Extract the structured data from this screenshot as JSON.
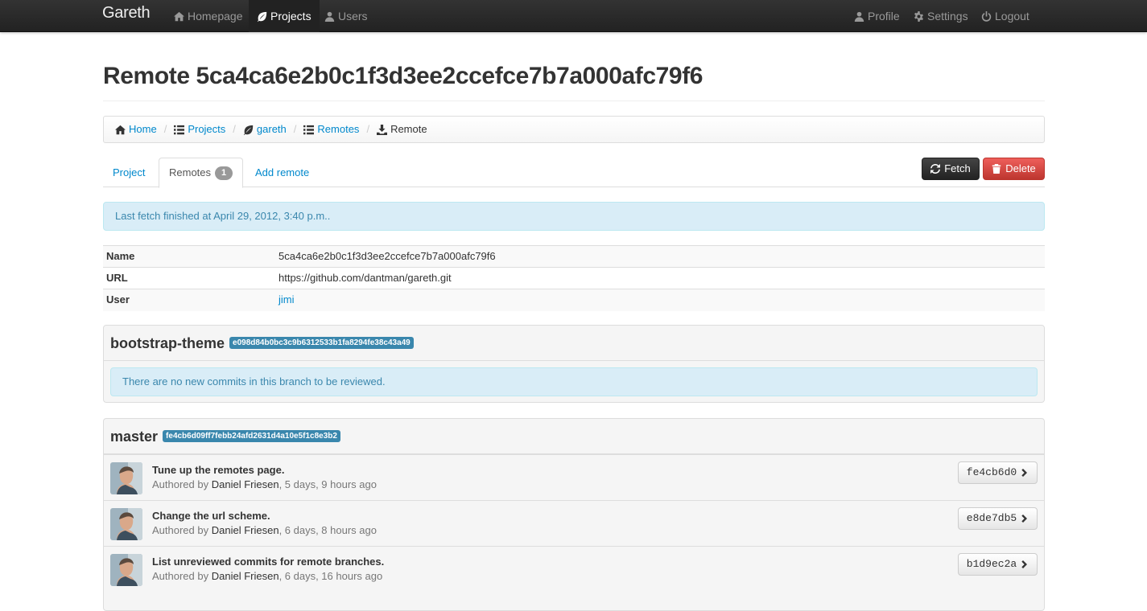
{
  "navbar": {
    "brand": "Gareth",
    "items": [
      {
        "label": "Homepage",
        "icon": "home-icon"
      },
      {
        "label": "Projects",
        "icon": "leaf-icon",
        "active": true
      },
      {
        "label": "Users",
        "icon": "user-icon"
      }
    ],
    "right_items": [
      {
        "label": "Profile",
        "icon": "user-icon"
      },
      {
        "label": "Settings",
        "icon": "gear-icon"
      },
      {
        "label": "Logout",
        "icon": "power-icon"
      }
    ]
  },
  "page": {
    "title": "Remote 5ca4ca6e2b0c1f3d3ee2ccefce7b7a000afc79f6"
  },
  "breadcrumb": [
    {
      "label": "Home",
      "icon": "home-icon"
    },
    {
      "label": "Projects",
      "icon": "list-icon"
    },
    {
      "label": "gareth",
      "icon": "leaf-icon"
    },
    {
      "label": "Remotes",
      "icon": "list-icon"
    },
    {
      "label": "Remote",
      "icon": "download-icon",
      "active": true
    }
  ],
  "tabs": {
    "project": "Project",
    "remotes": "Remotes",
    "remotes_count": "1",
    "add_remote": "Add remote"
  },
  "actions": {
    "fetch": "Fetch",
    "delete": "Delete"
  },
  "fetch_alert": "Last fetch finished at April 29, 2012, 3:40 p.m..",
  "details": [
    {
      "key": "Name",
      "value": "5ca4ca6e2b0c1f3d3ee2ccefce7b7a000afc79f6"
    },
    {
      "key": "URL",
      "value": "https://github.com/dantman/gareth.git"
    },
    {
      "key": "User",
      "value": "jimi"
    }
  ],
  "branches": [
    {
      "name": "bootstrap-theme",
      "sha": "e098d84b0bc3c9b6312533b1fa8294fe38c43a49",
      "empty_message": "There are no new commits in this branch to be reviewed."
    },
    {
      "name": "master",
      "sha": "fe4cb6d09ff7febb24afd2631d4a10e5f1c8e3b2",
      "commits": [
        {
          "title": "Tune up the remotes page.",
          "authored_by": "Authored by",
          "author": "Daniel Friesen",
          "age": ", 5 days, 9 hours ago",
          "short_sha": "fe4cb6d0"
        },
        {
          "title": "Change the url scheme.",
          "authored_by": "Authored by",
          "author": "Daniel Friesen",
          "age": ", 6 days, 8 hours ago",
          "short_sha": "e8de7db5"
        },
        {
          "title": "List unreviewed commits for remote branches.",
          "authored_by": "Authored by",
          "author": "Daniel Friesen",
          "age": ", 6 days, 16 hours ago",
          "short_sha": "b1d9ec2a"
        }
      ]
    }
  ],
  "colors": {
    "navbar": "#222222",
    "link": "#0088cc",
    "danger": "#da4f49",
    "info_bg": "#d9edf7",
    "label_info": "#3a87ad"
  }
}
